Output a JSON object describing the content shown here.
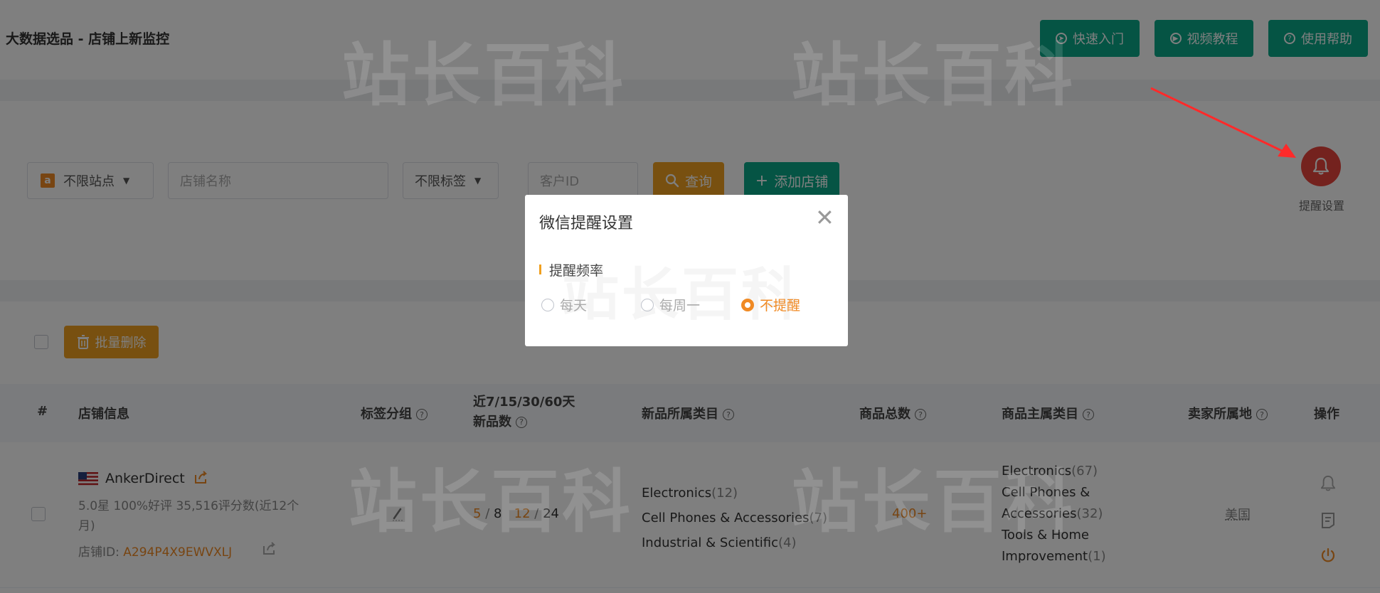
{
  "header": {
    "title": "大数据选品 - 店铺上新监控",
    "buttons": [
      {
        "label": "快速入门",
        "icon": "send-icon"
      },
      {
        "label": "视频教程",
        "icon": "play-icon"
      },
      {
        "label": "使用帮助",
        "icon": "help-icon"
      }
    ]
  },
  "filters": {
    "site_select": "不限站点",
    "site_icon_letter": "a",
    "shop_name_placeholder": "店铺名称",
    "tag_select": "不限标签",
    "customer_id_placeholder": "客户ID",
    "search_label": "查询",
    "add_label": "添加店铺"
  },
  "reminder": {
    "label": "提醒设置"
  },
  "bulk": {
    "delete_label": "批量删除"
  },
  "table": {
    "headers": {
      "index": "#",
      "shop_info": "店铺信息",
      "tag_group": "标签分组",
      "new_count_line1": "近7/15/30/60天",
      "new_count_line2": "新品数",
      "new_categories": "新品所属类目",
      "total_products": "商品总数",
      "main_categories": "商品主属类目",
      "seller_location": "卖家所属地",
      "actions": "操作"
    },
    "rows": [
      {
        "shop_name": "AnkerDirect",
        "rating_line1": "5.0星 100%好评 35,516评分数(近12个",
        "rating_line2": "月)",
        "shop_id_label": "店铺ID: ",
        "shop_id": "A294P4X9EWVXLJ",
        "counts": {
          "d7": "5",
          "d15": "8",
          "d30": "12",
          "d60": "24",
          "sep": "/"
        },
        "new_categories": [
          {
            "name": "Electronics",
            "count": "(12)"
          },
          {
            "name": "Cell Phones & Accessories",
            "count": "(7)"
          },
          {
            "name": "Industrial & Scientific",
            "count": "(4)"
          }
        ],
        "total": "400+",
        "main_categories": [
          {
            "name": "Electronics",
            "count": "(67)"
          },
          {
            "name": "Cell Phones &",
            "count": ""
          },
          {
            "name": "Accessories",
            "count": "(32)"
          },
          {
            "name": "Tools & Home",
            "count": ""
          },
          {
            "name": "Improvement",
            "count": "(1)"
          }
        ],
        "location": "美国"
      }
    ]
  },
  "watermark": "站长百科",
  "modal": {
    "title": "微信提醒设置",
    "close": "✕",
    "section": "提醒频率",
    "options": [
      {
        "label": "每天",
        "selected": false
      },
      {
        "label": "每周一",
        "selected": false
      },
      {
        "label": "不提醒",
        "selected": true
      }
    ]
  },
  "colors": {
    "primary_green": "#0aa889",
    "accent_orange": "#f08a24",
    "bell_red": "#e8453c",
    "arrow_red": "#ff2a2a"
  }
}
